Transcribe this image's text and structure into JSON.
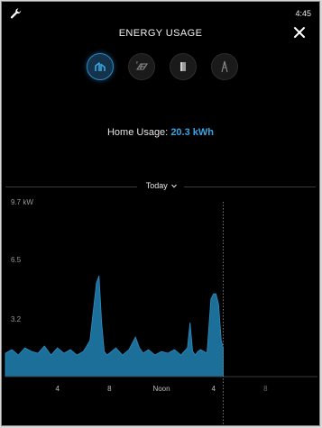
{
  "status_bar": {
    "time": "4:45",
    "wrench_icon": "wrench-icon"
  },
  "header": {
    "title": "ENERGY USAGE",
    "close_icon": "close-icon"
  },
  "sources": [
    {
      "name": "home",
      "icon": "home-icon",
      "active": true
    },
    {
      "name": "solar",
      "icon": "solar-icon",
      "active": false
    },
    {
      "name": "battery",
      "icon": "battery-icon",
      "active": false
    },
    {
      "name": "grid",
      "icon": "grid-icon",
      "active": false
    }
  ],
  "summary": {
    "label": "Home Usage:",
    "value": "20.3 kWh"
  },
  "period": {
    "selected": "Today"
  },
  "colors": {
    "accent": "#3aa4e2",
    "area_fill": "#1c6f99",
    "area_stroke": "#2b8fc4",
    "background": "#000000"
  },
  "chart_data": {
    "type": "area",
    "title": "",
    "xlabel": "",
    "ylabel": "",
    "y_unit": "kW",
    "ylim": [
      0,
      9.7
    ],
    "y_ticks": [
      {
        "value": 9.7,
        "label": "9.7 kW"
      },
      {
        "value": 6.5,
        "label": "6.5"
      },
      {
        "value": 3.2,
        "label": "3.2"
      }
    ],
    "xlim": [
      0,
      24
    ],
    "x_ticks": [
      {
        "value": 4,
        "label": "4"
      },
      {
        "value": 8,
        "label": "8"
      },
      {
        "value": 12,
        "label": "Noon"
      },
      {
        "value": 16,
        "label": "4"
      },
      {
        "value": 20,
        "label": "8"
      }
    ],
    "now_hour": 16.75,
    "grid": false,
    "series": [
      {
        "x": [
          0,
          0.5,
          1,
          1.5,
          2,
          2.5,
          3,
          3.5,
          4,
          4.5,
          5,
          5.5,
          6,
          6.5,
          7,
          7.2,
          7.4,
          7.6,
          7.8,
          8,
          8.5,
          9,
          9.5,
          10,
          10.3,
          10.6,
          11,
          11.5,
          12,
          12.5,
          13,
          13.5,
          14,
          14.2,
          14.4,
          14.6,
          14.8,
          15,
          15.5,
          15.8,
          16,
          16.2,
          16.4,
          16.6,
          16.75
        ],
        "y": [
          1.3,
          1.5,
          1.2,
          1.6,
          1.4,
          1.3,
          1.7,
          1.2,
          1.6,
          1.3,
          1.5,
          1.2,
          1.4,
          2.0,
          5.2,
          5.6,
          3.0,
          1.4,
          1.2,
          1.3,
          1.6,
          1.2,
          1.5,
          2.2,
          1.6,
          1.3,
          1.5,
          1.2,
          1.4,
          1.3,
          1.5,
          1.2,
          1.6,
          3.0,
          1.4,
          1.2,
          1.4,
          1.5,
          1.3,
          4.3,
          4.6,
          4.6,
          4.0,
          2.0,
          1.6
        ]
      }
    ]
  }
}
